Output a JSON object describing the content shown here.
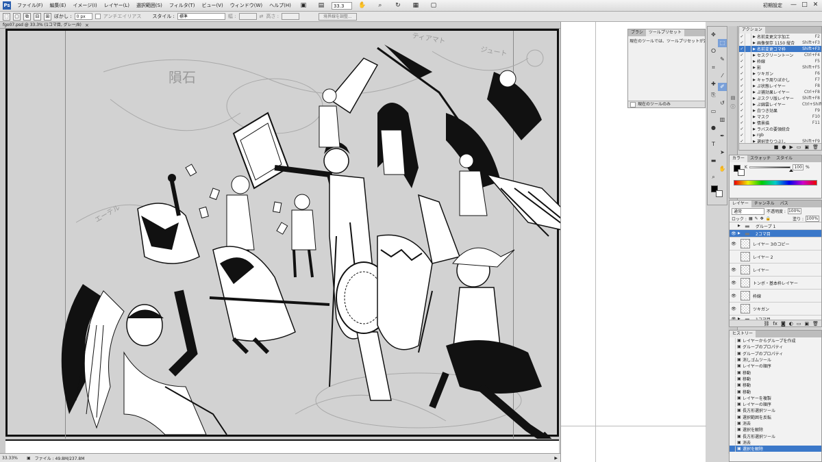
{
  "menubar": {
    "app_logo": "Ps",
    "items": [
      "ファイル(F)",
      "編集(E)",
      "イメージ(I)",
      "レイヤー(L)",
      "選択範囲(S)",
      "フィルタ(T)",
      "ビュー(V)",
      "ウィンドウ(W)",
      "ヘルプ(H)"
    ],
    "zoom": "33.3",
    "workspace": "初期設定",
    "win_min": "—",
    "win_max": "□",
    "win_close": "✕"
  },
  "options": {
    "feather_label": "ぼかし :",
    "feather_value": "0 px",
    "antialias_label": "アンチエイリアス",
    "style_label": "スタイル :",
    "style_value": "標準",
    "width_label": "幅 :",
    "height_label": "高さ :",
    "refine_button": "境界線を調整..."
  },
  "document": {
    "tab_title": "fgo07.psd @ 33.3% (1コマ目, グレー/8)",
    "tab_close": "×",
    "status_zoom": "33.33%",
    "status_file": "ファイル : 49.8M/237.8M",
    "handwriting_1": "隕石",
    "handwriting_2": "ティアマト",
    "handwriting_3": "ジュート",
    "handwriting_4": "エーテル"
  },
  "tool_presets": {
    "tabs": [
      "ブラシ",
      "ツールプリセット"
    ],
    "message": "現在のツールでは、ツールプリセットが定義されていません",
    "footer_label": "現在のツールのみ"
  },
  "actions": {
    "title": "アクション",
    "items": [
      {
        "name": "名前変更文字加工",
        "key": "F2",
        "selected": false
      },
      {
        "name": "画像保存 1150 縦合",
        "key": "Shift+F3",
        "selected": false
      },
      {
        "name": "名前変更コマ枠",
        "key": "Shift+F3",
        "selected": true
      },
      {
        "name": "セスクリーントーン",
        "key": "Ctrl+F4",
        "selected": false
      },
      {
        "name": "枠線",
        "key": "F5",
        "selected": false
      },
      {
        "name": "影",
        "key": "Shift+F5",
        "selected": false
      },
      {
        "name": "ツキガン",
        "key": "F6",
        "selected": false
      },
      {
        "name": "キャラ周りぼかし",
        "key": "F7",
        "selected": false
      },
      {
        "name": "ぷ状態レイヤー",
        "key": "F8",
        "selected": false
      },
      {
        "name": "ぷ捕効果レイヤー",
        "key": "Ctrl+F8",
        "selected": false
      },
      {
        "name": "ぷスクリ版レイヤー",
        "key": "Shift+F8",
        "selected": false
      },
      {
        "name": "ぷ綿雲レイヤー",
        "key": "Ctrl+Shift+F8",
        "selected": false
      },
      {
        "name": "白つき効果",
        "key": "F9",
        "selected": false
      },
      {
        "name": "マスク",
        "key": "F10",
        "selected": false
      },
      {
        "name": "情景描",
        "key": "F11",
        "selected": false
      },
      {
        "name": "ラバスの要領統合",
        "key": "",
        "selected": false
      },
      {
        "name": "rgb",
        "key": "",
        "selected": false
      },
      {
        "name": "選択塗りつぶし",
        "key": "Shift+F9",
        "selected": false
      }
    ]
  },
  "color_panel": {
    "tabs": [
      "カラー",
      "スウォッチ",
      "スタイル"
    ],
    "channel_label": "K",
    "value": "100",
    "unit": "%",
    "k_level": 1.0
  },
  "layers_panel": {
    "tabs": [
      "レイヤー",
      "チャンネル",
      "パス"
    ],
    "blend_mode": "通常",
    "opacity_label": "不透明度 :",
    "opacity": "100%",
    "lock_label": "ロック :",
    "fill_label": "塗り :",
    "fill": "100%",
    "layers": [
      {
        "name": "グループ 1",
        "type": "group",
        "visible": false,
        "selected": false,
        "short": true
      },
      {
        "name": "2コマ目",
        "type": "group",
        "visible": true,
        "selected": true,
        "short": true
      },
      {
        "name": "レイヤー 3のコピー",
        "type": "layer",
        "visible": true,
        "selected": false,
        "short": false
      },
      {
        "name": "レイヤー 2",
        "type": "layer",
        "visible": false,
        "selected": false,
        "short": false
      },
      {
        "name": "レイヤー",
        "type": "layer",
        "visible": true,
        "selected": false,
        "short": false
      },
      {
        "name": "トンボ・基本枠レイヤー",
        "type": "layer",
        "visible": true,
        "selected": false,
        "short": false
      },
      {
        "name": "枠線",
        "type": "layer",
        "visible": true,
        "selected": false,
        "short": false
      },
      {
        "name": "ツキガン",
        "type": "layer",
        "visible": true,
        "selected": false,
        "short": false
      },
      {
        "name": "1コマ目",
        "type": "group",
        "visible": true,
        "selected": false,
        "short": true
      }
    ]
  },
  "history": {
    "title": "ヒストリー",
    "items": [
      {
        "name": "レイヤーからグループを作成",
        "selected": false
      },
      {
        "name": "グループのプロパティ",
        "selected": false
      },
      {
        "name": "グループのプロパティ",
        "selected": false
      },
      {
        "name": "消しゴムツール",
        "selected": false
      },
      {
        "name": "レイヤーの順序",
        "selected": false
      },
      {
        "name": "移動",
        "selected": false
      },
      {
        "name": "移動",
        "selected": false
      },
      {
        "name": "移動",
        "selected": false
      },
      {
        "name": "移動",
        "selected": false
      },
      {
        "name": "レイヤーを複製",
        "selected": false
      },
      {
        "name": "レイヤーの順序",
        "selected": false
      },
      {
        "name": "長方形選択ツール",
        "selected": false
      },
      {
        "name": "選択範囲を反転",
        "selected": false
      },
      {
        "name": "消去",
        "selected": false
      },
      {
        "name": "選択を解除",
        "selected": false
      },
      {
        "name": "長方形選択ツール",
        "selected": false
      },
      {
        "name": "消去",
        "selected": false
      },
      {
        "name": "選択を解除",
        "selected": true
      }
    ]
  },
  "tools": [
    "move",
    "marquee",
    "lasso",
    "quick-select",
    "crop",
    "eyedropper",
    "healing",
    "brush",
    "clone",
    "history-brush",
    "eraser",
    "gradient",
    "dodge",
    "pen",
    "type",
    "path-select",
    "shape",
    "hand",
    "zoom"
  ]
}
